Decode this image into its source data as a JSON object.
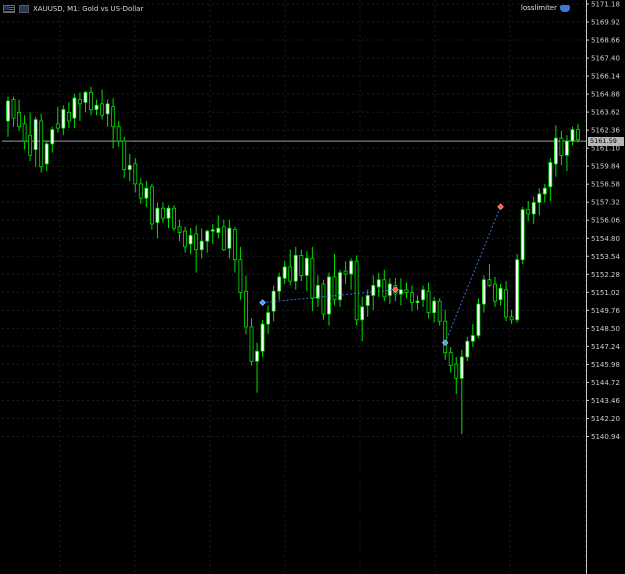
{
  "window": {
    "symbol": "XAUUSD",
    "timeframe": "M1",
    "description": "Gold vs US-Dollar",
    "title": "XAUUSD, M1:  Gold vs US-Dollar",
    "expert_name": "losslimiter",
    "current_price": "5161.59"
  },
  "price_axis": {
    "labels": [
      "5171.18",
      "5169.92",
      "5168.66",
      "5167.40",
      "5166.14",
      "5164.88",
      "5163.62",
      "5162.36",
      "5161.10",
      "5159.84",
      "5158.58",
      "5157.32",
      "5156.06",
      "5154.80",
      "5153.54",
      "5152.28",
      "5151.02",
      "5149.76",
      "5148.50",
      "5147.24",
      "5145.98",
      "5144.72",
      "5143.46",
      "5142.20",
      "5140.94"
    ]
  },
  "colors": {
    "background": "#000000",
    "grid": "#1c1c1c",
    "bull_candle": "#ffffff",
    "bear_candle": "#000000",
    "candle_outline": "#00e000",
    "axis_text": "#d0d0d0",
    "bid_line": "#9a9a9a",
    "trade_line": "#3a6fd8",
    "buy_marker": "#4aa0ff",
    "sell_marker": "#ff5a4a"
  },
  "chart_data": {
    "type": "candlestick",
    "ylim": [
      5140.3,
      5171.2
    ],
    "grid": true,
    "bid_price": 5161.59,
    "candles": [
      [
        5163.0,
        5164.7,
        5161.9,
        5164.4
      ],
      [
        5164.5,
        5164.7,
        5162.6,
        5163.2
      ],
      [
        5163.6,
        5164.5,
        5162.3,
        5162.6
      ],
      [
        5162.8,
        5163.4,
        5161.0,
        5161.6
      ],
      [
        5162.0,
        5163.6,
        5160.2,
        5160.6
      ],
      [
        5161.0,
        5163.3,
        5159.8,
        5163.1
      ],
      [
        5163.0,
        5163.5,
        5159.4,
        5159.8
      ],
      [
        5160.0,
        5161.6,
        5159.5,
        5161.4
      ],
      [
        5161.4,
        5162.6,
        5160.8,
        5162.4
      ],
      [
        5162.8,
        5164.0,
        5162.2,
        5162.5
      ],
      [
        5162.5,
        5164.1,
        5162.0,
        5163.8
      ],
      [
        5163.6,
        5164.3,
        5162.5,
        5163.0
      ],
      [
        5163.2,
        5164.9,
        5162.5,
        5164.6
      ],
      [
        5164.5,
        5165.0,
        5163.0,
        5164.2
      ],
      [
        5164.3,
        5165.1,
        5163.6,
        5165.0
      ],
      [
        5165.0,
        5165.4,
        5163.4,
        5163.8
      ],
      [
        5163.8,
        5164.5,
        5163.4,
        5164.1
      ],
      [
        5164.2,
        5165.2,
        5163.1,
        5163.4
      ],
      [
        5163.5,
        5164.5,
        5162.6,
        5164.2
      ],
      [
        5164.0,
        5164.6,
        5161.1,
        5162.6
      ],
      [
        5162.6,
        5163.0,
        5161.2,
        5161.6
      ],
      [
        5161.6,
        5161.9,
        5159.0,
        5159.6
      ],
      [
        5159.6,
        5160.7,
        5158.8,
        5159.9
      ],
      [
        5160.0,
        5160.4,
        5158.0,
        5158.6
      ],
      [
        5158.6,
        5159.0,
        5157.2,
        5157.6
      ],
      [
        5157.6,
        5158.8,
        5157.0,
        5158.3
      ],
      [
        5158.4,
        5158.6,
        5155.4,
        5155.8
      ],
      [
        5155.9,
        5157.3,
        5154.8,
        5156.9
      ],
      [
        5156.9,
        5157.3,
        5155.9,
        5156.2
      ],
      [
        5156.2,
        5157.1,
        5155.5,
        5156.9
      ],
      [
        5156.9,
        5157.1,
        5155.3,
        5155.5
      ],
      [
        5155.6,
        5156.1,
        5154.6,
        5155.2
      ],
      [
        5155.3,
        5155.6,
        5153.8,
        5154.2
      ],
      [
        5154.4,
        5155.5,
        5153.7,
        5155.0
      ],
      [
        5155.1,
        5155.7,
        5152.4,
        5154.0
      ],
      [
        5154.0,
        5155.5,
        5153.4,
        5154.6
      ],
      [
        5154.6,
        5155.4,
        5153.8,
        5155.3
      ],
      [
        5155.3,
        5155.8,
        5154.4,
        5155.4
      ],
      [
        5155.2,
        5156.4,
        5154.8,
        5155.5
      ],
      [
        5155.6,
        5156.1,
        5153.9,
        5154.0
      ],
      [
        5154.1,
        5156.1,
        5153.4,
        5155.5
      ],
      [
        5155.4,
        5155.6,
        5152.4,
        5153.3
      ],
      [
        5153.3,
        5154.2,
        5150.5,
        5151.0
      ],
      [
        5151.1,
        5152.2,
        5148.1,
        5148.6
      ],
      [
        5148.6,
        5149.2,
        5145.9,
        5146.2
      ],
      [
        5146.2,
        5147.5,
        5144.0,
        5146.9
      ],
      [
        5146.9,
        5149.1,
        5146.5,
        5148.8
      ],
      [
        5148.8,
        5150.1,
        5148.1,
        5149.6
      ],
      [
        5149.7,
        5151.5,
        5149.0,
        5151.1
      ],
      [
        5151.1,
        5152.4,
        5150.5,
        5152.1
      ],
      [
        5152.0,
        5153.2,
        5151.6,
        5152.8
      ],
      [
        5152.8,
        5154.0,
        5151.5,
        5151.8
      ],
      [
        5151.8,
        5154.2,
        5151.2,
        5153.6
      ],
      [
        5153.6,
        5154.0,
        5151.8,
        5152.2
      ],
      [
        5152.2,
        5153.9,
        5151.1,
        5153.4
      ],
      [
        5153.4,
        5154.2,
        5149.7,
        5150.6
      ],
      [
        5150.6,
        5152.2,
        5150.0,
        5151.5
      ],
      [
        5151.6,
        5151.9,
        5149.1,
        5149.5
      ],
      [
        5149.5,
        5152.4,
        5148.7,
        5152.1
      ],
      [
        5152.1,
        5153.7,
        5150.1,
        5150.5
      ],
      [
        5150.5,
        5152.6,
        5150.0,
        5152.4
      ],
      [
        5152.5,
        5153.2,
        5151.6,
        5152.3
      ],
      [
        5152.3,
        5153.4,
        5151.2,
        5153.2
      ],
      [
        5153.2,
        5153.6,
        5148.7,
        5149.1
      ],
      [
        5149.1,
        5150.7,
        5147.6,
        5150.0
      ],
      [
        5150.1,
        5151.2,
        5149.3,
        5150.8
      ],
      [
        5150.8,
        5152.2,
        5149.8,
        5151.5
      ],
      [
        5151.4,
        5152.4,
        5150.7,
        5151.9
      ],
      [
        5151.9,
        5152.6,
        5150.4,
        5150.7
      ],
      [
        5150.8,
        5152.0,
        5150.2,
        5151.6
      ],
      [
        5151.5,
        5152.0,
        5150.4,
        5150.9
      ],
      [
        5150.9,
        5152.0,
        5150.1,
        5151.2
      ],
      [
        5151.2,
        5151.7,
        5150.6,
        5151.0
      ],
      [
        5151.0,
        5151.5,
        5149.7,
        5150.3
      ],
      [
        5150.3,
        5150.8,
        5149.8,
        5150.4
      ],
      [
        5150.5,
        5151.5,
        5150.0,
        5151.2
      ],
      [
        5151.1,
        5151.7,
        5149.2,
        5149.6
      ],
      [
        5149.6,
        5150.7,
        5148.9,
        5150.4
      ],
      [
        5150.4,
        5150.6,
        5148.7,
        5149.0
      ],
      [
        5149.0,
        5149.8,
        5146.3,
        5146.8
      ],
      [
        5146.8,
        5147.2,
        5145.4,
        5145.9
      ],
      [
        5146.0,
        5146.5,
        5143.9,
        5145.0
      ],
      [
        5145.0,
        5147.0,
        5141.1,
        5146.5
      ],
      [
        5146.5,
        5147.9,
        5146.2,
        5147.6
      ],
      [
        5147.6,
        5148.8,
        5147.2,
        5148.0
      ],
      [
        5148.0,
        5150.6,
        5147.8,
        5150.2
      ],
      [
        5150.2,
        5152.2,
        5149.6,
        5151.9
      ],
      [
        5151.9,
        5153.0,
        5151.4,
        5151.5
      ],
      [
        5151.6,
        5152.1,
        5150.0,
        5150.4
      ],
      [
        5150.5,
        5151.6,
        5150.1,
        5151.3
      ],
      [
        5151.2,
        5151.8,
        5149.0,
        5149.3
      ],
      [
        5149.3,
        5149.8,
        5148.8,
        5149.1
      ],
      [
        5149.1,
        5153.7,
        5148.9,
        5153.3
      ],
      [
        5153.3,
        5157.0,
        5153.0,
        5156.8
      ],
      [
        5156.8,
        5157.4,
        5156.0,
        5156.5
      ],
      [
        5156.5,
        5157.7,
        5155.8,
        5157.3
      ],
      [
        5157.3,
        5158.3,
        5156.4,
        5157.9
      ],
      [
        5157.9,
        5158.6,
        5157.3,
        5158.3
      ],
      [
        5158.4,
        5160.4,
        5157.4,
        5160.1
      ],
      [
        5160.0,
        5162.7,
        5159.1,
        5161.8
      ],
      [
        5161.8,
        5162.3,
        5159.9,
        5160.6
      ],
      [
        5160.6,
        5162.0,
        5159.5,
        5161.6
      ],
      [
        5161.6,
        5162.6,
        5161.3,
        5162.4
      ],
      [
        5162.4,
        5162.8,
        5161.5,
        5161.7
      ]
    ],
    "trades": [
      {
        "entry_index": 46,
        "entry_price": 5150.3,
        "exit_index": 70,
        "exit_price": 5151.2
      },
      {
        "entry_index": 79,
        "entry_price": 5147.5,
        "exit_index": 89,
        "exit_price": 5157.0
      }
    ]
  }
}
